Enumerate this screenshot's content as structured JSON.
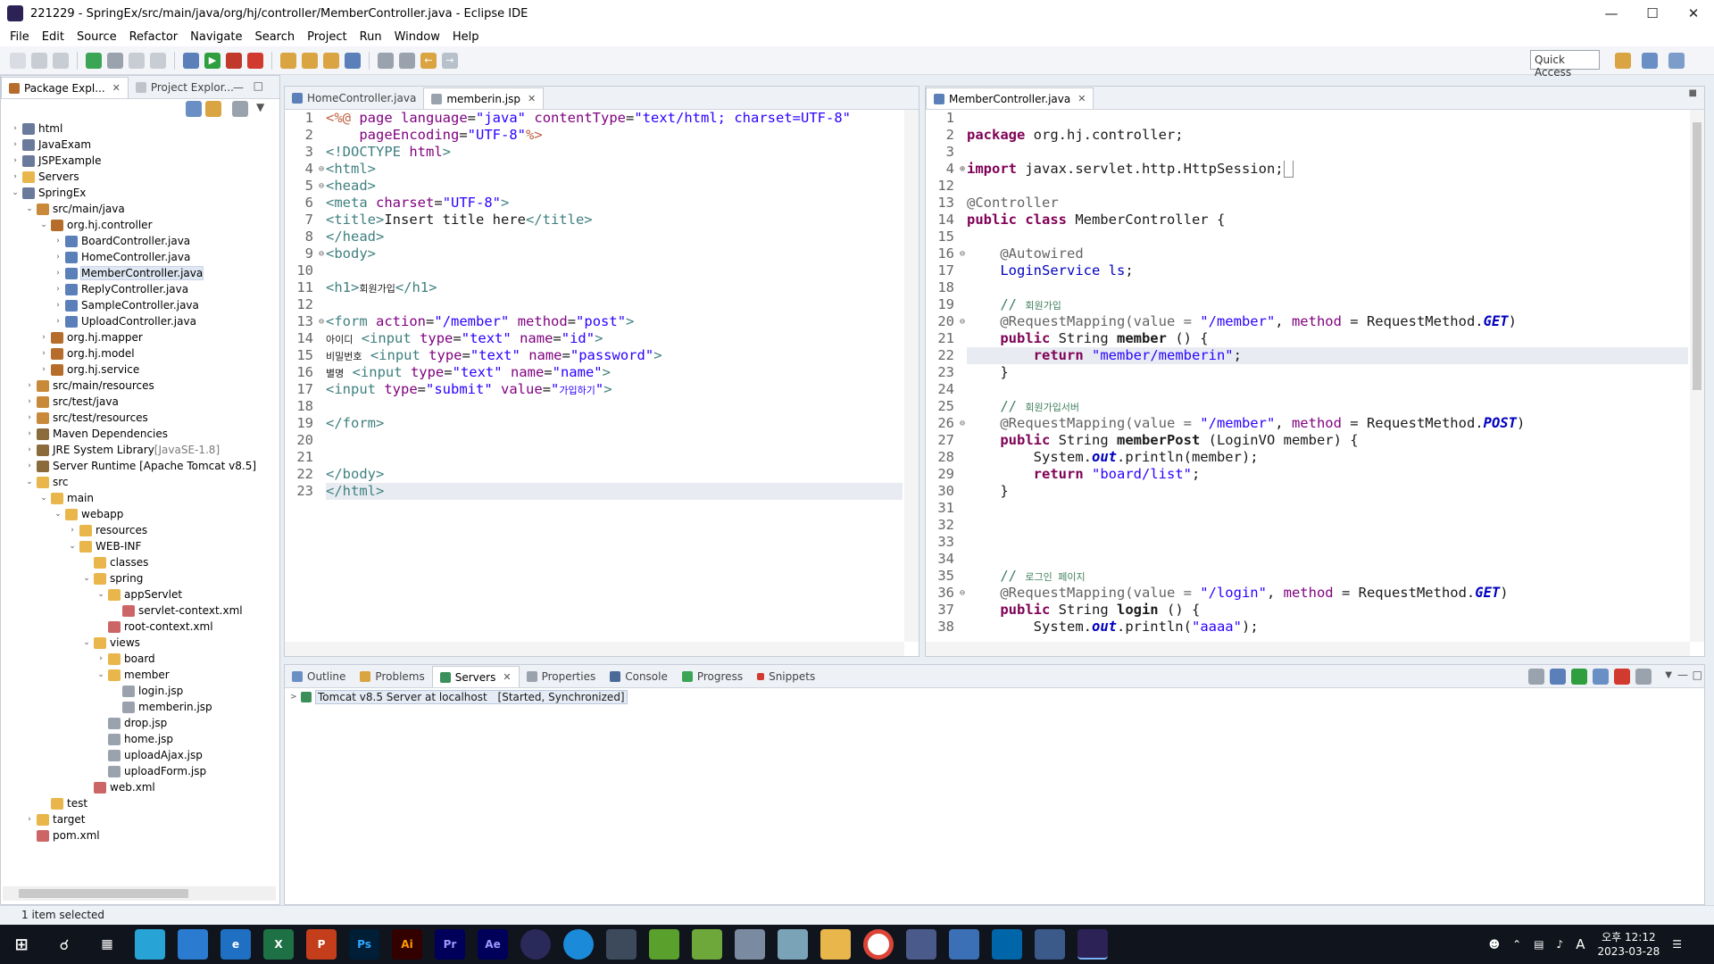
{
  "window": {
    "title": "221229 - SpringEx/src/main/java/org/hj/controller/MemberController.java - Eclipse IDE"
  },
  "menu": [
    "File",
    "Edit",
    "Source",
    "Refactor",
    "Navigate",
    "Search",
    "Project",
    "Run",
    "Window",
    "Help"
  ],
  "toolbar": {
    "quick_access": "Quick Access"
  },
  "package_explorer": {
    "tabs": [
      "Package Expl...",
      "Project Explor..."
    ],
    "tree": [
      {
        "d": 0,
        "a": ">",
        "i": "proj",
        "t": "html"
      },
      {
        "d": 0,
        "a": ">",
        "i": "proj",
        "t": "JavaExam"
      },
      {
        "d": 0,
        "a": ">",
        "i": "proj",
        "t": "JSPExample"
      },
      {
        "d": 0,
        "a": ">",
        "i": "folder",
        "t": "Servers"
      },
      {
        "d": 0,
        "a": "v",
        "i": "proj",
        "t": "SpringEx"
      },
      {
        "d": 1,
        "a": "v",
        "i": "src",
        "t": "src/main/java"
      },
      {
        "d": 2,
        "a": "v",
        "i": "pkg",
        "t": "org.hj.controller"
      },
      {
        "d": 3,
        "a": ">",
        "i": "java",
        "t": "BoardController.java"
      },
      {
        "d": 3,
        "a": ">",
        "i": "java",
        "t": "HomeController.java"
      },
      {
        "d": 3,
        "a": ">",
        "i": "java",
        "t": "MemberController.java",
        "sel": true
      },
      {
        "d": 3,
        "a": ">",
        "i": "java",
        "t": "ReplyController.java"
      },
      {
        "d": 3,
        "a": ">",
        "i": "java",
        "t": "SampleController.java"
      },
      {
        "d": 3,
        "a": ">",
        "i": "java",
        "t": "UploadController.java"
      },
      {
        "d": 2,
        "a": ">",
        "i": "pkg",
        "t": "org.hj.mapper"
      },
      {
        "d": 2,
        "a": ">",
        "i": "pkg",
        "t": "org.hj.model"
      },
      {
        "d": 2,
        "a": ">",
        "i": "pkg",
        "t": "org.hj.service"
      },
      {
        "d": 1,
        "a": ">",
        "i": "src",
        "t": "src/main/resources"
      },
      {
        "d": 1,
        "a": ">",
        "i": "src",
        "t": "src/test/java"
      },
      {
        "d": 1,
        "a": ">",
        "i": "src",
        "t": "src/test/resources"
      },
      {
        "d": 1,
        "a": ">",
        "i": "lib",
        "t": "Maven Dependencies"
      },
      {
        "d": 1,
        "a": ">",
        "i": "lib",
        "t": "JRE System Library",
        "g": " [JavaSE-1.8]"
      },
      {
        "d": 1,
        "a": ">",
        "i": "lib",
        "t": "Server Runtime [Apache Tomcat v8.5]"
      },
      {
        "d": 1,
        "a": "v",
        "i": "folder",
        "t": "src"
      },
      {
        "d": 2,
        "a": "v",
        "i": "folder",
        "t": "main"
      },
      {
        "d": 3,
        "a": "v",
        "i": "folder",
        "t": "webapp"
      },
      {
        "d": 4,
        "a": ">",
        "i": "folder",
        "t": "resources"
      },
      {
        "d": 4,
        "a": "v",
        "i": "folder",
        "t": "WEB-INF"
      },
      {
        "d": 5,
        "a": "",
        "i": "folder",
        "t": "classes"
      },
      {
        "d": 5,
        "a": "v",
        "i": "folder",
        "t": "spring"
      },
      {
        "d": 6,
        "a": "v",
        "i": "folder",
        "t": "appServlet"
      },
      {
        "d": 7,
        "a": "",
        "i": "xml",
        "t": "servlet-context.xml"
      },
      {
        "d": 6,
        "a": "",
        "i": "xml",
        "t": "root-context.xml"
      },
      {
        "d": 5,
        "a": "v",
        "i": "folder",
        "t": "views"
      },
      {
        "d": 6,
        "a": ">",
        "i": "folder",
        "t": "board"
      },
      {
        "d": 6,
        "a": "v",
        "i": "folder",
        "t": "member"
      },
      {
        "d": 7,
        "a": "",
        "i": "jsp",
        "t": "login.jsp"
      },
      {
        "d": 7,
        "a": "",
        "i": "jsp",
        "t": "memberin.jsp"
      },
      {
        "d": 6,
        "a": "",
        "i": "jsp",
        "t": "drop.jsp"
      },
      {
        "d": 6,
        "a": "",
        "i": "jsp",
        "t": "home.jsp"
      },
      {
        "d": 6,
        "a": "",
        "i": "jsp",
        "t": "uploadAjax.jsp"
      },
      {
        "d": 6,
        "a": "",
        "i": "jsp",
        "t": "uploadForm.jsp"
      },
      {
        "d": 5,
        "a": "",
        "i": "xml",
        "t": "web.xml"
      },
      {
        "d": 2,
        "a": "",
        "i": "folder",
        "t": "test"
      },
      {
        "d": 1,
        "a": ">",
        "i": "folder",
        "t": "target"
      },
      {
        "d": 1,
        "a": "",
        "i": "xml",
        "t": "pom.xml"
      }
    ]
  },
  "editor_left": {
    "tabs": [
      "HomeController.java",
      "memberin.jsp"
    ],
    "lines": [
      {
        "n": "1",
        "f": "",
        "h": "<span class='jsp'>&lt;%@</span> <span class='attr'>page language</span>=<span class='str'>\"java\"</span> <span class='attr'>contentType</span>=<span class='str'>\"text/html; charset=UTF-8\"</span>"
      },
      {
        "n": "2",
        "f": "",
        "h": "    <span class='attr'>pageEncoding</span>=<span class='str'>\"UTF-8\"</span><span class='jsp'>%&gt;</span>"
      },
      {
        "n": "3",
        "f": "",
        "h": "<span class='tag'>&lt;!DOCTYPE</span> <span class='attr'>html</span><span class='tag'>&gt;</span>"
      },
      {
        "n": "4",
        "f": "⊖",
        "h": "<span class='tag'>&lt;html&gt;</span>"
      },
      {
        "n": "5",
        "f": "⊖",
        "h": "<span class='tag'>&lt;head&gt;</span>"
      },
      {
        "n": "6",
        "f": "",
        "h": "<span class='tag'>&lt;meta</span> <span class='attr'>charset</span>=<span class='str'>\"UTF-8\"</span><span class='tag'>&gt;</span>"
      },
      {
        "n": "7",
        "f": "",
        "h": "<span class='tag'>&lt;title&gt;</span>Insert title here<span class='tag'>&lt;/title&gt;</span>"
      },
      {
        "n": "8",
        "f": "",
        "h": "<span class='tag'>&lt;/head&gt;</span>"
      },
      {
        "n": "9",
        "f": "⊖",
        "h": "<span class='tag'>&lt;body&gt;</span>"
      },
      {
        "n": "10",
        "f": "",
        "h": ""
      },
      {
        "n": "11",
        "f": "",
        "h": "<span class='tag'>&lt;h1&gt;</span><span style='font-size:11px'>회원가입</span><span class='tag'>&lt;/h1&gt;</span>"
      },
      {
        "n": "12",
        "f": "",
        "h": ""
      },
      {
        "n": "13",
        "f": "⊖",
        "h": "<span class='tag'>&lt;form</span> <span class='attr'>action</span>=<span class='str'>\"/member\"</span> <span class='attr'>method</span>=<span class='str'>\"post\"</span><span class='tag'>&gt;</span>"
      },
      {
        "n": "14",
        "f": "",
        "h": "<span style='font-size:11px'>아이디</span> <span class='tag'>&lt;input</span> <span class='attr'>type</span>=<span class='str'>\"text\"</span> <span class='attr'>name</span>=<span class='str'>\"id\"</span><span class='tag'>&gt;</span>"
      },
      {
        "n": "15",
        "f": "",
        "h": "<span style='font-size:11px'>비밀번호</span> <span class='tag'>&lt;input</span> <span class='attr'>type</span>=<span class='str'>\"text\"</span> <span class='attr'>name</span>=<span class='str'>\"password\"</span><span class='tag'>&gt;</span>"
      },
      {
        "n": "16",
        "f": "",
        "h": "<span style='font-size:11px'>별명</span> <span class='tag'>&lt;input</span> <span class='attr'>type</span>=<span class='str'>\"text\"</span> <span class='attr'>name</span>=<span class='str'>\"name\"</span><span class='tag'>&gt;</span>"
      },
      {
        "n": "17",
        "f": "",
        "h": "<span class='tag'>&lt;input</span> <span class='attr'>type</span>=<span class='str'>\"submit\"</span> <span class='attr'>value</span>=<span class='str'>\"<span style='font-size:11px'>가입하기</span>\"</span><span class='tag'>&gt;</span>"
      },
      {
        "n": "18",
        "f": "",
        "h": ""
      },
      {
        "n": "19",
        "f": "",
        "h": "<span class='tag'>&lt;/form&gt;</span>"
      },
      {
        "n": "20",
        "f": "",
        "h": ""
      },
      {
        "n": "21",
        "f": "",
        "h": ""
      },
      {
        "n": "22",
        "f": "",
        "h": "<span class='tag'>&lt;/body&gt;</span>"
      },
      {
        "n": "23",
        "f": "",
        "h": "<span class='tag'>&lt;/html&gt;</span>",
        "hl": true
      }
    ]
  },
  "editor_right": {
    "tabs": [
      "MemberController.java"
    ],
    "lines": [
      {
        "n": "1",
        "f": "",
        "h": ""
      },
      {
        "n": "2",
        "f": "",
        "h": "<span class='kw'>package</span> org.hj.controller;"
      },
      {
        "n": "3",
        "f": "",
        "h": ""
      },
      {
        "n": "4",
        "f": "⊕",
        "h": "<span class='kw'>import</span> javax.servlet.http.HttpSession;<span style='border:1px solid #888'>&nbsp;</span>"
      },
      {
        "n": "12",
        "f": "",
        "h": ""
      },
      {
        "n": "13",
        "f": "",
        "h": "<span class='ann'>@Controller</span>"
      },
      {
        "n": "14",
        "f": "",
        "h": "<span class='kw'>public class</span> MemberController {"
      },
      {
        "n": "15",
        "f": "",
        "h": ""
      },
      {
        "n": "16",
        "f": "⊖",
        "h": "    <span class='ann'>@Autowired</span>"
      },
      {
        "n": "17",
        "f": "",
        "h": "    <span class='fld'>LoginService ls</span>;"
      },
      {
        "n": "18",
        "f": "",
        "h": ""
      },
      {
        "n": "19",
        "f": "",
        "h": "    <span class='cmt'>// <span style='font-size:11px'>회원가입</span></span>"
      },
      {
        "n": "20",
        "f": "⊖",
        "h": "    <span class='ann'>@RequestMapping(value = </span><span class='strg'>\"/member\"</span>, <span class='attr'>method</span> = RequestMethod.<span class='bi'>GET</span>)"
      },
      {
        "n": "21",
        "f": "",
        "h": "    <span class='kw'>public</span> String <b>member</b> () {"
      },
      {
        "n": "22",
        "f": "",
        "h": "        <span class='kw'>return</span> <span class='strg'>\"member/memberin\"</span>;",
        "hl": true
      },
      {
        "n": "23",
        "f": "",
        "h": "    }"
      },
      {
        "n": "24",
        "f": "",
        "h": ""
      },
      {
        "n": "25",
        "f": "",
        "h": "    <span class='cmt'>// <span style='font-size:11px'>회원가입서버</span></span>"
      },
      {
        "n": "26",
        "f": "⊖",
        "h": "    <span class='ann'>@RequestMapping(value = </span><span class='strg'>\"/member\"</span>, <span class='attr'>method</span> = RequestMethod.<span class='bi'>POST</span>)"
      },
      {
        "n": "27",
        "f": "",
        "h": "    <span class='kw'>public</span> String <b>memberPost</b> (LoginVO member) {"
      },
      {
        "n": "28",
        "f": "",
        "h": "        System.<span class='bi'>out</span>.println(member);"
      },
      {
        "n": "29",
        "f": "",
        "h": "        <span class='kw'>return</span> <span class='strg'>\"board/list\"</span>;"
      },
      {
        "n": "30",
        "f": "",
        "h": "    }"
      },
      {
        "n": "31",
        "f": "",
        "h": ""
      },
      {
        "n": "32",
        "f": "",
        "h": ""
      },
      {
        "n": "33",
        "f": "",
        "h": ""
      },
      {
        "n": "34",
        "f": "",
        "h": ""
      },
      {
        "n": "35",
        "f": "",
        "h": "    <span class='cmt'>// <span style='font-size:11px'>로그인 페이지</span></span>"
      },
      {
        "n": "36",
        "f": "⊖",
        "h": "    <span class='ann'>@RequestMapping(value = </span><span class='strg'>\"/login\"</span>, <span class='attr'>method</span> = RequestMethod.<span class='bi'>GET</span>)"
      },
      {
        "n": "37",
        "f": "",
        "h": "    <span class='kw'>public</span> String <b>login</b> () {"
      },
      {
        "n": "38",
        "f": "",
        "h": "        System.<span class='bi'>out</span>.println(<span class='strg'>\"aaaa\"</span>);"
      }
    ]
  },
  "bottom_panel": {
    "tabs": [
      "Outline",
      "Problems",
      "Servers",
      "Properties",
      "Console",
      "Progress",
      "Snippets"
    ],
    "active_tab": "Servers",
    "server_row": {
      "name": "Tomcat v8.5 Server at localhost",
      "state": "[Started, Synchronized]"
    }
  },
  "status": {
    "text": "1 item selected"
  },
  "taskbar": {
    "clock_time": "오후 12:12",
    "clock_date": "2023-03-28",
    "ime": "A"
  }
}
